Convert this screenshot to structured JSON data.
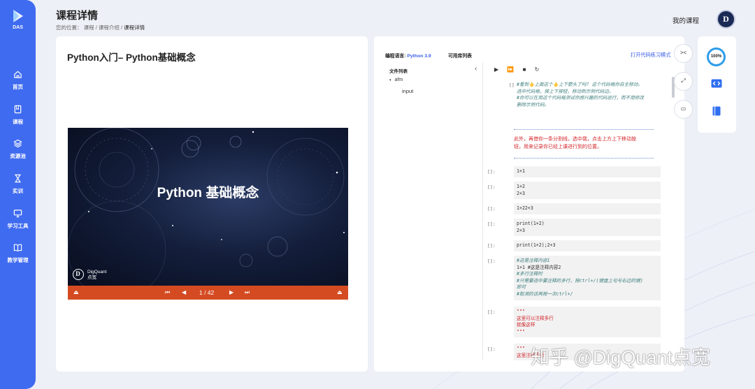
{
  "sidebar": {
    "logo_text": "DAS",
    "items": [
      {
        "label": "首页",
        "icon": "home-icon"
      },
      {
        "label": "课程",
        "icon": "book-icon"
      },
      {
        "label": "资源池",
        "icon": "layers-icon"
      },
      {
        "label": "实训",
        "icon": "hourglass-icon"
      },
      {
        "label": "学习工具",
        "icon": "monitor-icon"
      },
      {
        "label": "教学管理",
        "icon": "open-book-icon"
      }
    ]
  },
  "header": {
    "title": "课程详情",
    "breadcrumb_prefix": "您的位置：",
    "breadcrumb": [
      "课程",
      "课程介绍",
      "课程详情"
    ],
    "separator": "/",
    "my_course": "我的课程",
    "avatar_letter": "D"
  },
  "lesson": {
    "title": "Python入门– Python基础概念",
    "slide_title": "Python 基础概念",
    "brand_letter": "D",
    "brand_name": "DigQuant",
    "brand_cn": "点宽",
    "page": "1 / 42"
  },
  "notebook": {
    "lang_label": "编程语言:",
    "lang_value": "Python 3.9",
    "libs_tab": "可用库列表",
    "open_mode": "打开代码练习模式",
    "file_list_title": "文件列表",
    "files": [
      "afm",
      "input"
    ],
    "prompt_empty": "[]:",
    "cells": [
      {
        "lines": [
          "#看到👆上面这个👆上下箭头了吗? 这个代码格你自主移动。",
          "选中代码格，按上下按钮，移动到示例代码边。",
          "#你可以在用这个代码框测试你感兴趣的代码运行，而不用修改",
          "删除示例代码。"
        ]
      },
      {
        "md": [
          "此外，再借你一条分割线，选中我，点击上方上下移动按",
          "钮，用来记录你已经上课进行到的位置。"
        ]
      },
      {
        "lines": [
          "1+1"
        ]
      },
      {
        "lines": [
          "1+2",
          "2+3"
        ]
      },
      {
        "lines": [
          "1+22+3"
        ]
      },
      {
        "lines": [
          "print(1+2)",
          "2+3"
        ]
      },
      {
        "lines": [
          "print(1+2);2+3"
        ]
      },
      {
        "lines": [
          "#这是注释内容1",
          "1+1      #这是注释内容2",
          "#多行注释时",
          "#只需要选中要注释的多行，按ctrl+/(键盘上句号右边的键)",
          "即可",
          "#取消的话再按一次ctrl+/"
        ]
      },
      {
        "lines": [
          "\"\"\"",
          "这里可以注释多行",
          "就像这样",
          "\"\"\""
        ]
      },
      {
        "lines": [
          "\"\"\"",
          "这里注释多行"
        ]
      }
    ]
  },
  "tools": {
    "progress": "100%",
    "progress_value": 100
  },
  "watermark": "知乎 @DigQuant点宽",
  "colors": {
    "sidebar": "#3f6bf0",
    "accent": "#3a5ee6",
    "slide_bar": "#d44b22",
    "comment": "#3f7f7f",
    "markdown": "#d3252a"
  }
}
